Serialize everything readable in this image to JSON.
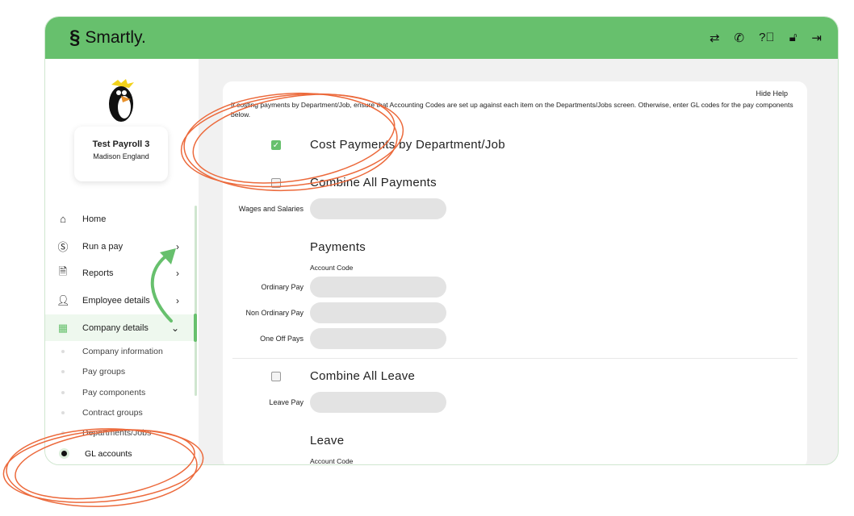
{
  "header": {
    "brand": "Smartly.",
    "icons": [
      "switch-icon",
      "phone-icon",
      "help-icon",
      "lock-icon",
      "logout-icon"
    ]
  },
  "profile": {
    "name": "Test Payroll 3",
    "location": "Madison England"
  },
  "sidebar": {
    "items": [
      {
        "label": "Home",
        "icon": "home-icon"
      },
      {
        "label": "Run a pay",
        "icon": "dollar-icon"
      },
      {
        "label": "Reports",
        "icon": "document-icon"
      },
      {
        "label": "Employee details",
        "icon": "person-icon"
      },
      {
        "label": "Company details",
        "icon": "building-icon"
      }
    ],
    "subitems": [
      "Company information",
      "Pay groups",
      "Pay components",
      "Contract groups",
      "Departments/Jobs",
      "GL accounts"
    ]
  },
  "main": {
    "hide_help": "Hide Help",
    "help_text": "If costing payments by Department/Job, ensure that Accounting Codes are set up against each item on the Departments/Jobs screen. Otherwise, enter GL codes for the pay components below.",
    "cost_by_dept": {
      "label": "Cost Payments by Department/Job",
      "checked": true
    },
    "combine_payments": {
      "label": "Combine All Payments",
      "checked": false
    },
    "wages_label": "Wages and Salaries",
    "payments_title": "Payments",
    "account_code": "Account Code",
    "payment_fields": [
      "Ordinary Pay",
      "Non Ordinary Pay",
      "One Off Pays"
    ],
    "combine_leave": {
      "label": "Combine All Leave",
      "checked": false
    },
    "leave_pay_label": "Leave Pay",
    "leave_title": "Leave",
    "leave_account_code": "Account Code"
  },
  "colors": {
    "brand": "#67c06d",
    "annotation": "#ec6a3c"
  }
}
